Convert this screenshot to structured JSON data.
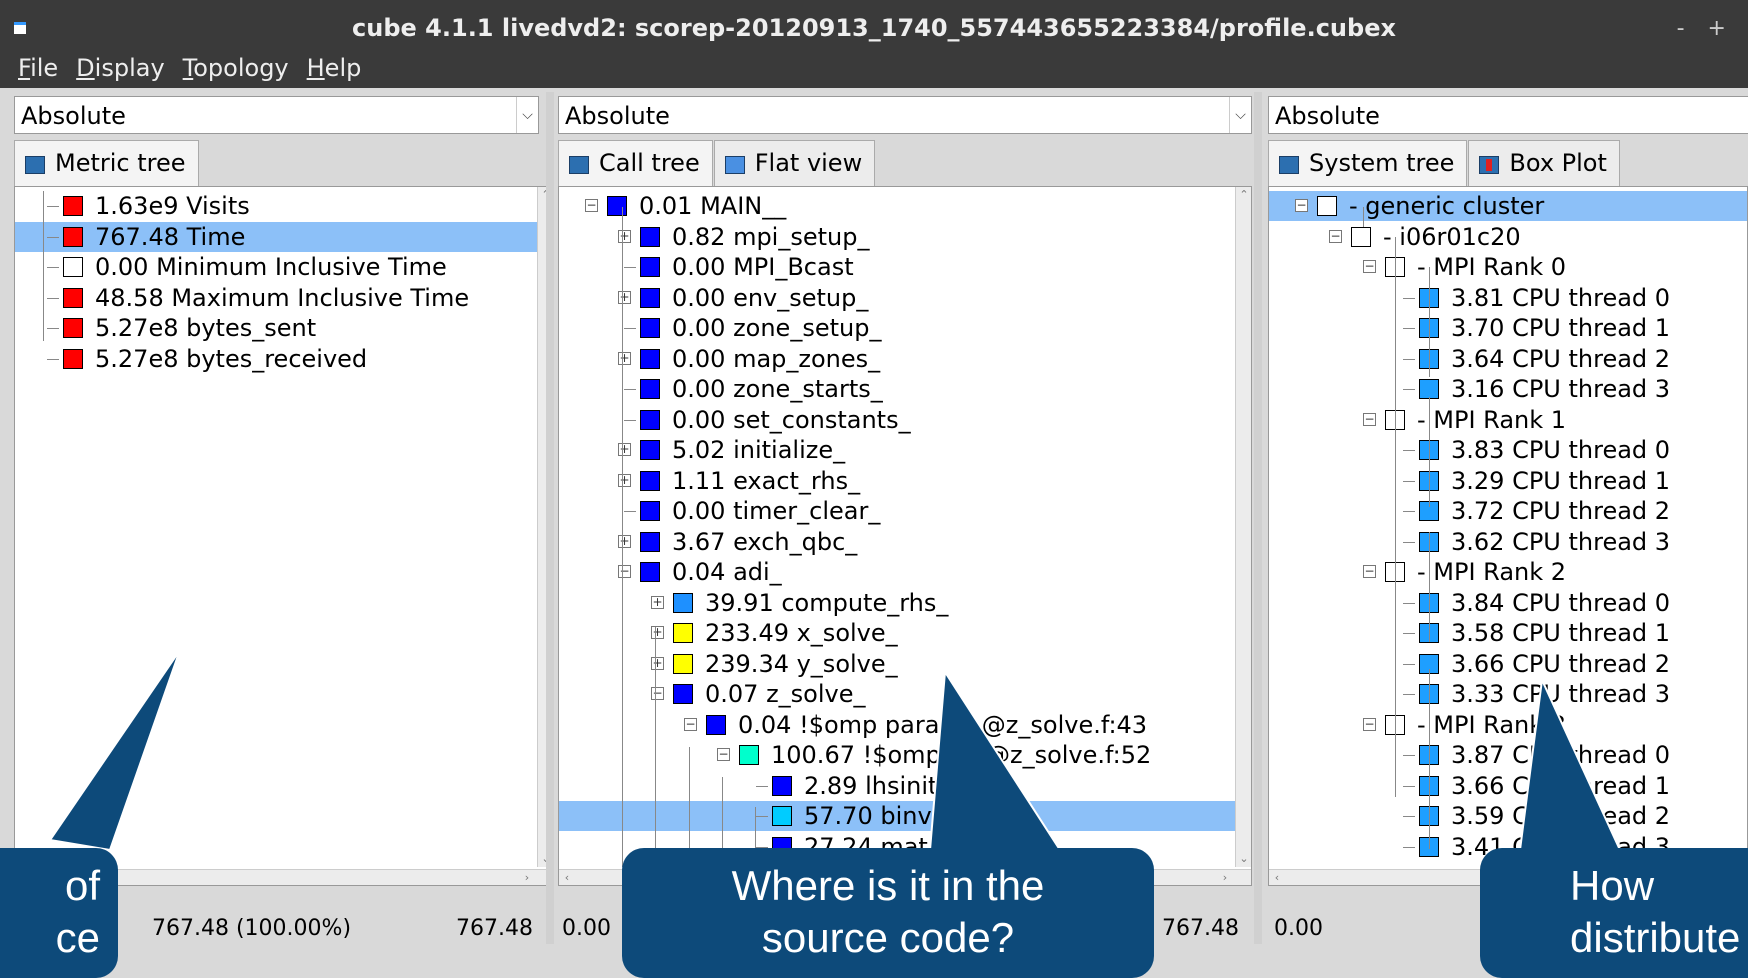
{
  "window": {
    "title": "cube 4.1.1 livedvd2: scorep-20120913_1740_557443655223384/profile.cubex",
    "controls": "- +"
  },
  "menu": [
    "File",
    "Display",
    "Topology",
    "Help"
  ],
  "left_panel": {
    "combo_value": "Absolute",
    "tabs": [
      {
        "label": "Metric tree"
      }
    ],
    "rows": [
      {
        "text": "1.63e9 Visits",
        "color": "#ff0000"
      },
      {
        "text": "767.48 Time",
        "color": "#ff0000",
        "selected": true
      },
      {
        "text": "0.00 Minimum Inclusive Time",
        "color": "#ffffff"
      },
      {
        "text": "48.58 Maximum Inclusive Time",
        "color": "#ff0000"
      },
      {
        "text": "5.27e8 bytes_sent",
        "color": "#ff0000"
      },
      {
        "text": "5.27e8 bytes_received",
        "color": "#ff0000"
      }
    ],
    "status_left": "767.48 (100.00%)",
    "status_right": "767.48"
  },
  "middle_panel": {
    "combo_value": "Absolute",
    "tabs": [
      {
        "label": "Call tree"
      },
      {
        "label": "Flat view"
      }
    ],
    "rows": [
      {
        "text": "0.01 MAIN__",
        "color": "#0000ff"
      },
      {
        "text": "0.82 mpi_setup_",
        "color": "#0000ff"
      },
      {
        "text": "0.00 MPI_Bcast",
        "color": "#0000ff"
      },
      {
        "text": "0.00 env_setup_",
        "color": "#0000ff"
      },
      {
        "text": "0.00 zone_setup_",
        "color": "#0000ff"
      },
      {
        "text": "0.00 map_zones_",
        "color": "#0000ff"
      },
      {
        "text": "0.00 zone_starts_",
        "color": "#0000ff"
      },
      {
        "text": "0.00 set_constants_",
        "color": "#0000ff"
      },
      {
        "text": "5.02 initialize_",
        "color": "#0000ff"
      },
      {
        "text": "1.11 exact_rhs_",
        "color": "#0000ff"
      },
      {
        "text": "0.00 timer_clear_",
        "color": "#0000ff"
      },
      {
        "text": "3.67 exch_qbc_",
        "color": "#0000ff"
      },
      {
        "text": "0.04 adi_",
        "color": "#0000ff"
      },
      {
        "text": "39.91 compute_rhs_",
        "color": "#1e90ff"
      },
      {
        "text": "233.49 x_solve_",
        "color": "#ffff00"
      },
      {
        "text": "239.34 y_solve_",
        "color": "#ffff00"
      },
      {
        "text": "0.07 z_solve_",
        "color": "#0000ff"
      },
      {
        "text": "0.04 !$omp parallel @z_solve.f:43",
        "color": "#0000ff"
      },
      {
        "text": "100.67 !$omp do @z_solve.f:52",
        "color": "#00ffcc"
      },
      {
        "text": "2.89 lhsinit_",
        "color": "#0000ff"
      },
      {
        "text": "57.70 binvcrhs_",
        "color": "#00ccff",
        "selected": true
      },
      {
        "text": "27.24 matmul_sub_",
        "color": "#0000ff"
      }
    ],
    "status_left": "0.00",
    "status_right": "767.48"
  },
  "right_panel": {
    "combo_value": "Absolute",
    "tabs": [
      {
        "label": "System tree"
      },
      {
        "label": "Box Plot"
      }
    ],
    "rows": [
      {
        "text": "- generic cluster",
        "color": "#ffffff",
        "selected": true
      },
      {
        "text": "- i06r01c20",
        "color": "#ffffff"
      },
      {
        "text": "- MPI Rank 0",
        "color": "#ffffff"
      },
      {
        "text": "3.81 CPU thread 0",
        "color": "#1e9fff"
      },
      {
        "text": "3.70 CPU thread 1",
        "color": "#1e9fff"
      },
      {
        "text": "3.64 CPU thread 2",
        "color": "#1e9fff"
      },
      {
        "text": "3.16 CPU thread 3",
        "color": "#1e9fff"
      },
      {
        "text": "- MPI Rank 1",
        "color": "#ffffff"
      },
      {
        "text": "3.83 CPU thread 0",
        "color": "#1e9fff"
      },
      {
        "text": "3.29 CPU thread 1",
        "color": "#1e9fff"
      },
      {
        "text": "3.72 CPU thread 2",
        "color": "#1e9fff"
      },
      {
        "text": "3.62 CPU thread 3",
        "color": "#1e9fff"
      },
      {
        "text": "- MPI Rank 2",
        "color": "#ffffff"
      },
      {
        "text": "3.84 CPU thread 0",
        "color": "#1e9fff"
      },
      {
        "text": "3.58 CPU thread 1",
        "color": "#1e9fff"
      },
      {
        "text": "3.66 CPU thread 2",
        "color": "#1e9fff"
      },
      {
        "text": "3.33 CPU thread 3",
        "color": "#1e9fff"
      },
      {
        "text": "- MPI Rank 3",
        "color": "#ffffff"
      },
      {
        "text": "3.87 CPU thread 0",
        "color": "#1e9fff"
      },
      {
        "text": "3.66 CPU thread 1",
        "color": "#1e9fff"
      },
      {
        "text": "3.59 CPU thread 2",
        "color": "#1e9fff"
      },
      {
        "text": "3.41 CPU thread 3",
        "color": "#1e9fff"
      }
    ],
    "status_left": "0.00"
  },
  "callouts": {
    "left": "of\nce",
    "middle": "Where is it in the\nsource code?",
    "right": "How\ndistribute"
  }
}
